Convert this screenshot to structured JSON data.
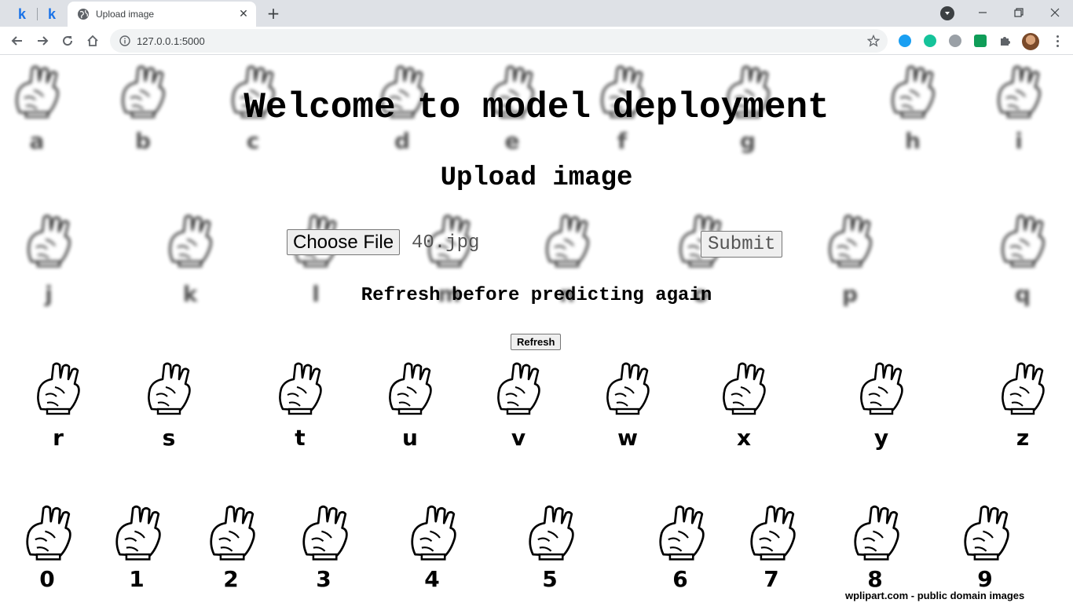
{
  "browser": {
    "pinned_tabs": [
      "k",
      "k"
    ],
    "active_tab_title": "Upload image",
    "url": "127.0.0.1:5000"
  },
  "page": {
    "title": "Welcome to model deployment",
    "subtitle": "Upload image",
    "choose_file_label": "Choose File",
    "file_name": "40.jpg",
    "submit_label": "Submit",
    "refresh_note": "Refresh before predicting again",
    "refresh_label": "Refresh",
    "credit": "wplipart.com - public domain images"
  },
  "background": {
    "blurred_row1": [
      "a",
      "b",
      "c",
      "d",
      "e",
      "f",
      "g",
      "h",
      "i"
    ],
    "blurred_row2": [
      "j",
      "k",
      "l",
      "m",
      "n",
      "o",
      "p",
      "q"
    ],
    "letters_row": [
      "r",
      "s",
      "t",
      "u",
      "v",
      "w",
      "x",
      "y",
      "z"
    ],
    "digits_row": [
      "0",
      "1",
      "2",
      "3",
      "4",
      "5",
      "6",
      "7",
      "8",
      "9"
    ]
  }
}
